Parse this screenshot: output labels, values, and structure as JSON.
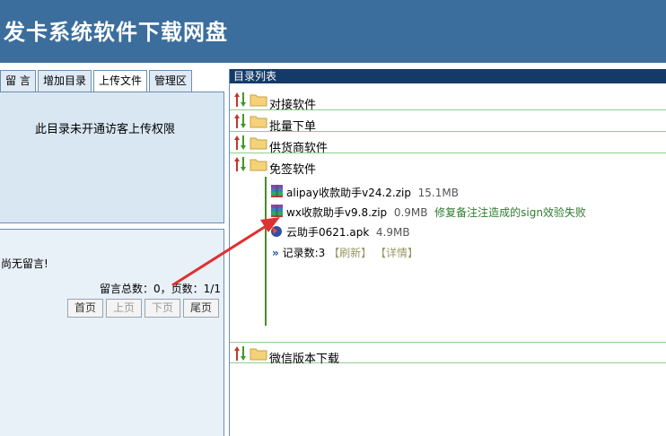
{
  "header": {
    "title": "发卡系统软件下载网盘"
  },
  "left": {
    "tabs": [
      {
        "label": "留 言"
      },
      {
        "label": "增加目录"
      },
      {
        "label": "上传文件"
      },
      {
        "label": "管理区"
      }
    ],
    "upload_message": "此目录未开通访客上传权限",
    "messages": {
      "empty_text": "尚无留言!",
      "stats_text": "留言总数：0，页数：1/1",
      "pager": {
        "first": "首页",
        "prev": "上页",
        "next": "下页",
        "last": "尾页"
      }
    }
  },
  "right": {
    "panel_title": "目录列表",
    "folders": [
      {
        "name": "对接软件"
      },
      {
        "name": "批量下单"
      },
      {
        "name": "供货商软件"
      },
      {
        "name": "免签软件"
      },
      {
        "name": "微信版本下载"
      }
    ],
    "files": [
      {
        "name": "alipay收款助手v24.2.zip",
        "size": "15.1MB",
        "note": "",
        "icon": "archive-icon"
      },
      {
        "name": "wx收款助手v9.8.zip",
        "size": "0.9MB",
        "note": "修复备注注造成的sign效验失败",
        "icon": "archive-icon"
      },
      {
        "name": "云助手0621.apk",
        "size": "4.9MB",
        "note": "",
        "icon": "apk-icon"
      }
    ],
    "records": {
      "arrow": "»",
      "label": "记录数:3",
      "refresh": "【刷新】",
      "detail": "【详情】"
    }
  },
  "colors": {
    "header_bg": "#3c6e9d",
    "dir_header_bg": "#143a68",
    "annotation_arrow": "#e03030",
    "tree_line": "#4a8a2a"
  }
}
